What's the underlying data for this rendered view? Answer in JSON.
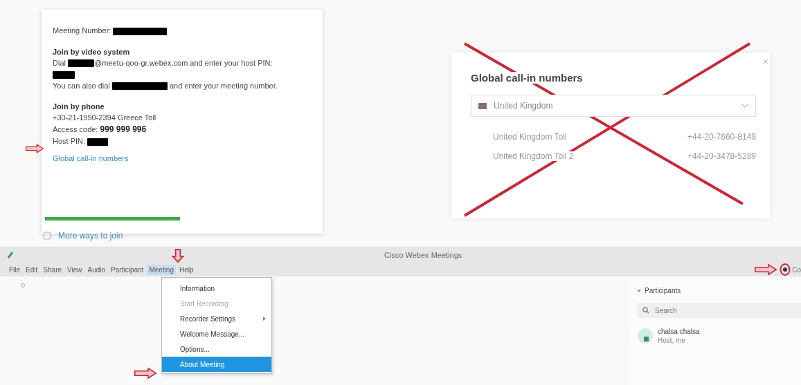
{
  "join_info": {
    "meeting_number_label": "Meeting Number:",
    "video_heading": "Join by video system",
    "video_dial_prefix": "Dial",
    "video_dial_rest": "@meetu-qoo-gr.webex.com and enter your host PIN:",
    "also_dial_prefix": "You can also dial",
    "also_dial_rest": "and enter your meeting number.",
    "phone_heading": "Join by phone",
    "phone_number": "+30-21-1990-2394 Greece Toll",
    "access_code_label": "Access code:",
    "access_code": "999 999 996",
    "host_pin_label": "Host PIN:",
    "global_link": "Global call-in numbers"
  },
  "more_ways": "More ways to join",
  "callin_dialog": {
    "title": "Global call-in numbers",
    "country": "United Kingdom",
    "rows": [
      {
        "name": "United Kingdom Toll",
        "number": "+44-20-7660-8149"
      },
      {
        "name": "United Kingdom Toll 2",
        "number": "+44-20-3478-5289"
      }
    ]
  },
  "window": {
    "title": "Cisco Webex Meetings",
    "title_right": "Co"
  },
  "menu_bar": [
    {
      "label": "File",
      "selected": false
    },
    {
      "label": "Edit",
      "selected": false
    },
    {
      "label": "Share",
      "selected": false
    },
    {
      "label": "View",
      "selected": false
    },
    {
      "label": "Audio",
      "selected": false
    },
    {
      "label": "Participant",
      "selected": false
    },
    {
      "label": "Meeting",
      "selected": true
    },
    {
      "label": "Help",
      "selected": false
    }
  ],
  "meeting_menu": [
    {
      "label": "Information",
      "disabled": false,
      "selected": false,
      "submenu": false
    },
    {
      "label": "Start Recording",
      "disabled": true,
      "selected": false,
      "submenu": false
    },
    {
      "label": "Recorder Settings",
      "disabled": false,
      "selected": false,
      "submenu": true
    },
    {
      "label": "Welcome Message...",
      "disabled": false,
      "selected": false,
      "submenu": false
    },
    {
      "label": "Options...",
      "disabled": false,
      "selected": false,
      "submenu": false
    },
    {
      "label": "About Meeting",
      "disabled": false,
      "selected": true,
      "submenu": false
    }
  ],
  "participants": {
    "title": "Participants",
    "search_placeholder": "Search",
    "people": [
      {
        "name": "chalsa chalsa",
        "role": "Host, me"
      }
    ]
  }
}
